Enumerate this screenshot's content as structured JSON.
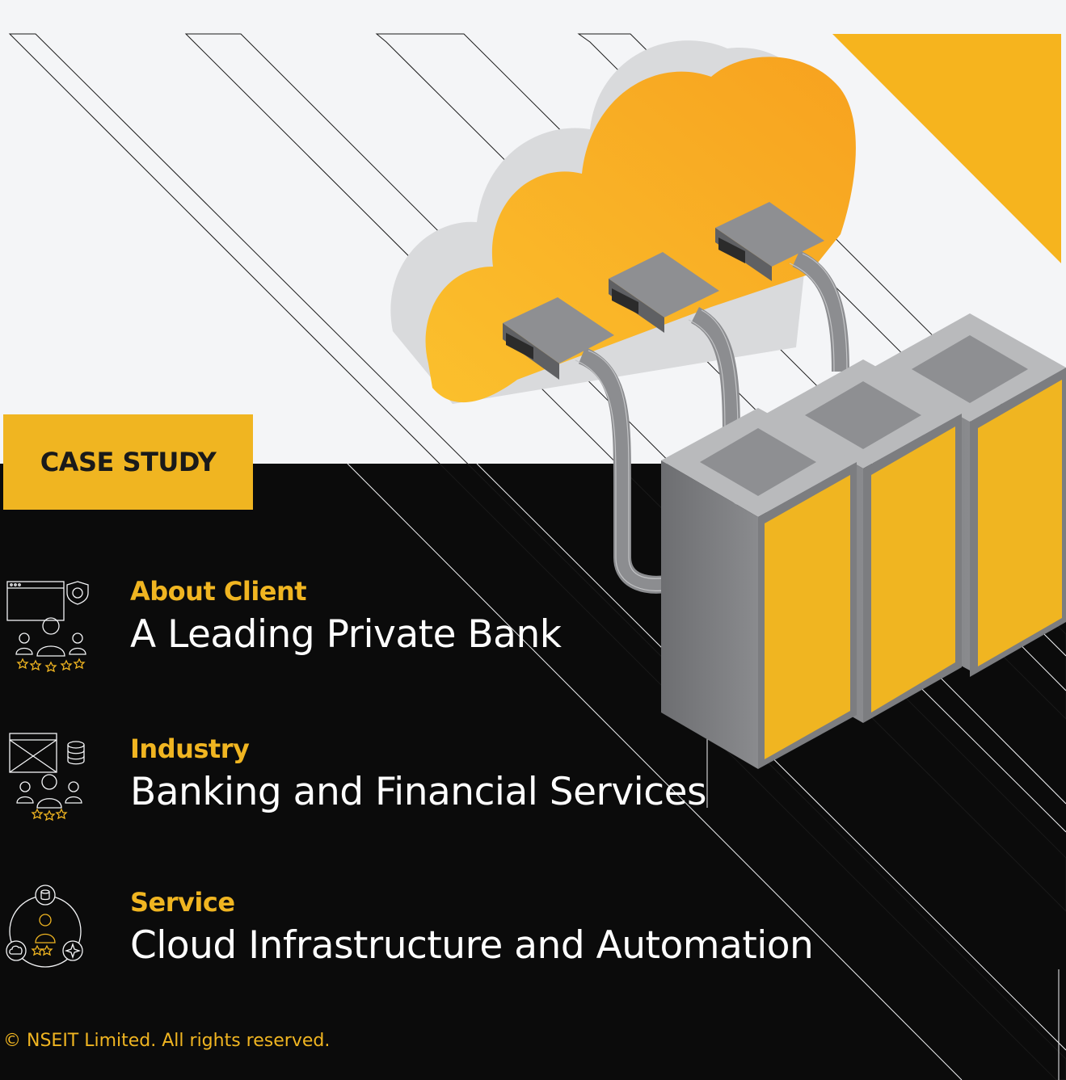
{
  "badge": {
    "label": "CASE STUDY"
  },
  "sections": [
    {
      "label": "About Client",
      "value": "A Leading Private Bank",
      "icon": "client-security-icon"
    },
    {
      "label": "Industry",
      "value": "Banking and Financial Services",
      "icon": "industry-data-icon"
    },
    {
      "label": "Service",
      "value": "Cloud Infrastructure and Automation",
      "icon": "service-cloud-icon"
    }
  ],
  "footer": {
    "copyright": "© NSEIT Limited. All rights reserved."
  },
  "colors": {
    "accent": "#f0b521",
    "dark": "#0b0b0b",
    "light": "#f4f5f7",
    "cloud_orange": "#f7a823"
  }
}
